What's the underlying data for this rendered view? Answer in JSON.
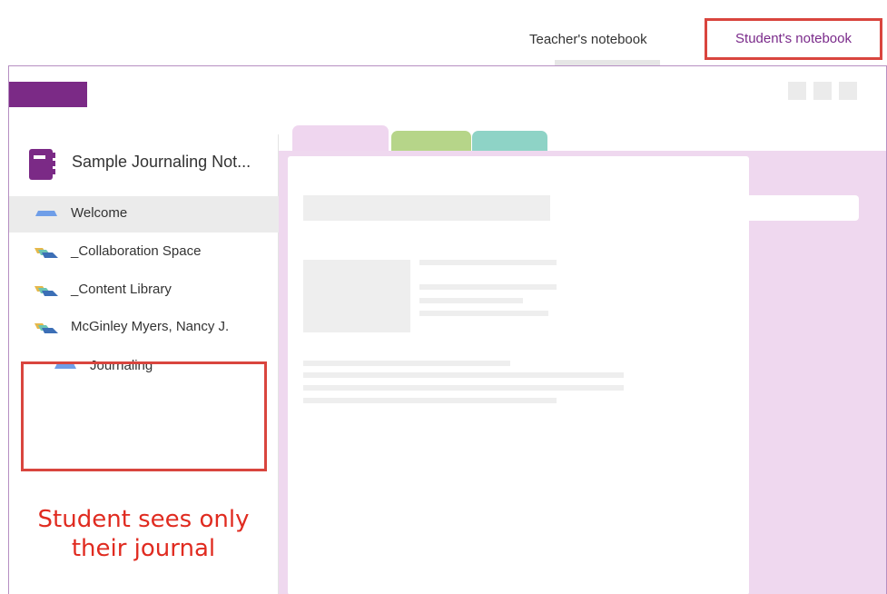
{
  "top_tabs": {
    "teacher": "Teacher's notebook",
    "student": "Student's notebook"
  },
  "notebook": {
    "title": "Sample Journaling Not..."
  },
  "sidebar": {
    "items": [
      {
        "label": "Welcome",
        "icon": "section-single-icon",
        "selected": true
      },
      {
        "label": "_Collaboration Space",
        "icon": "section-group-icon"
      },
      {
        "label": "_Content Library",
        "icon": "section-group-icon"
      },
      {
        "label": "McGinley Myers, Nancy J.",
        "icon": "section-group-icon"
      },
      {
        "label": "Journaling",
        "icon": "section-single-icon"
      }
    ]
  },
  "annotation": {
    "line1": "Student sees only",
    "line2": "their journal"
  },
  "colors": {
    "brand": "#7b2a86",
    "highlight": "#d9453e",
    "annotation": "#e02b20",
    "tab_pink": "#efd6ef",
    "tab_green": "#b6d589",
    "tab_teal": "#8ed3c6"
  }
}
